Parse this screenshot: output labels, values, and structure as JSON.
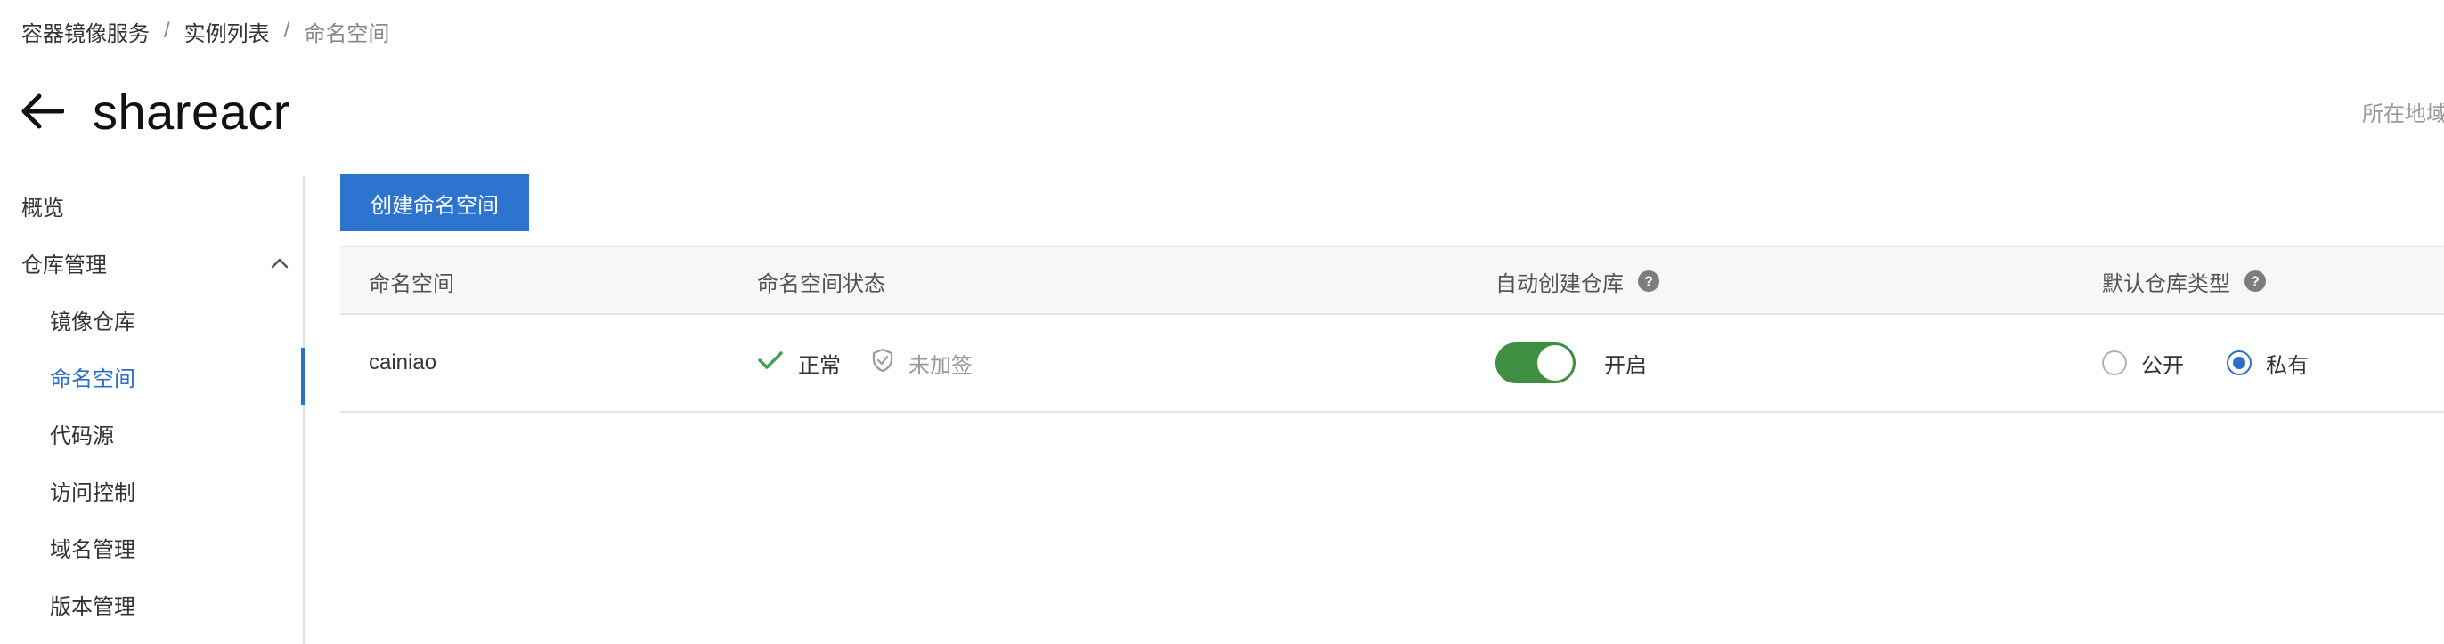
{
  "breadcrumb": {
    "items": [
      "容器镜像服务",
      "实例列表",
      "命名空间"
    ],
    "separator": "/"
  },
  "header": {
    "back_icon": "arrow-left-icon",
    "title": "shareacr",
    "region_label": "所在地域"
  },
  "sidebar": {
    "overview": "概览",
    "repo_group": "仓库管理",
    "repo_group_icon": "chevron-up-icon",
    "sub_items": [
      "镜像仓库",
      "命名空间",
      "代码源",
      "访问控制",
      "域名管理",
      "版本管理"
    ],
    "active_sub": "命名空间"
  },
  "toolbar": {
    "create_label": "创建命名空间"
  },
  "table": {
    "headers": {
      "namespace": "命名空间",
      "status": "命名空间状态",
      "auto_create": "自动创建仓库",
      "default_type": "默认仓库类型"
    },
    "rows": [
      {
        "namespace": "cainiao",
        "status": "正常",
        "sign_status": "未加签",
        "auto_create_enabled": true,
        "auto_create_label": "开启",
        "type_options": [
          "公开",
          "私有"
        ],
        "selected_type": "私有"
      }
    ]
  },
  "colors": {
    "accent": "#2d74cf",
    "toggle_on": "#3f8f43",
    "success": "#3fa34d"
  }
}
